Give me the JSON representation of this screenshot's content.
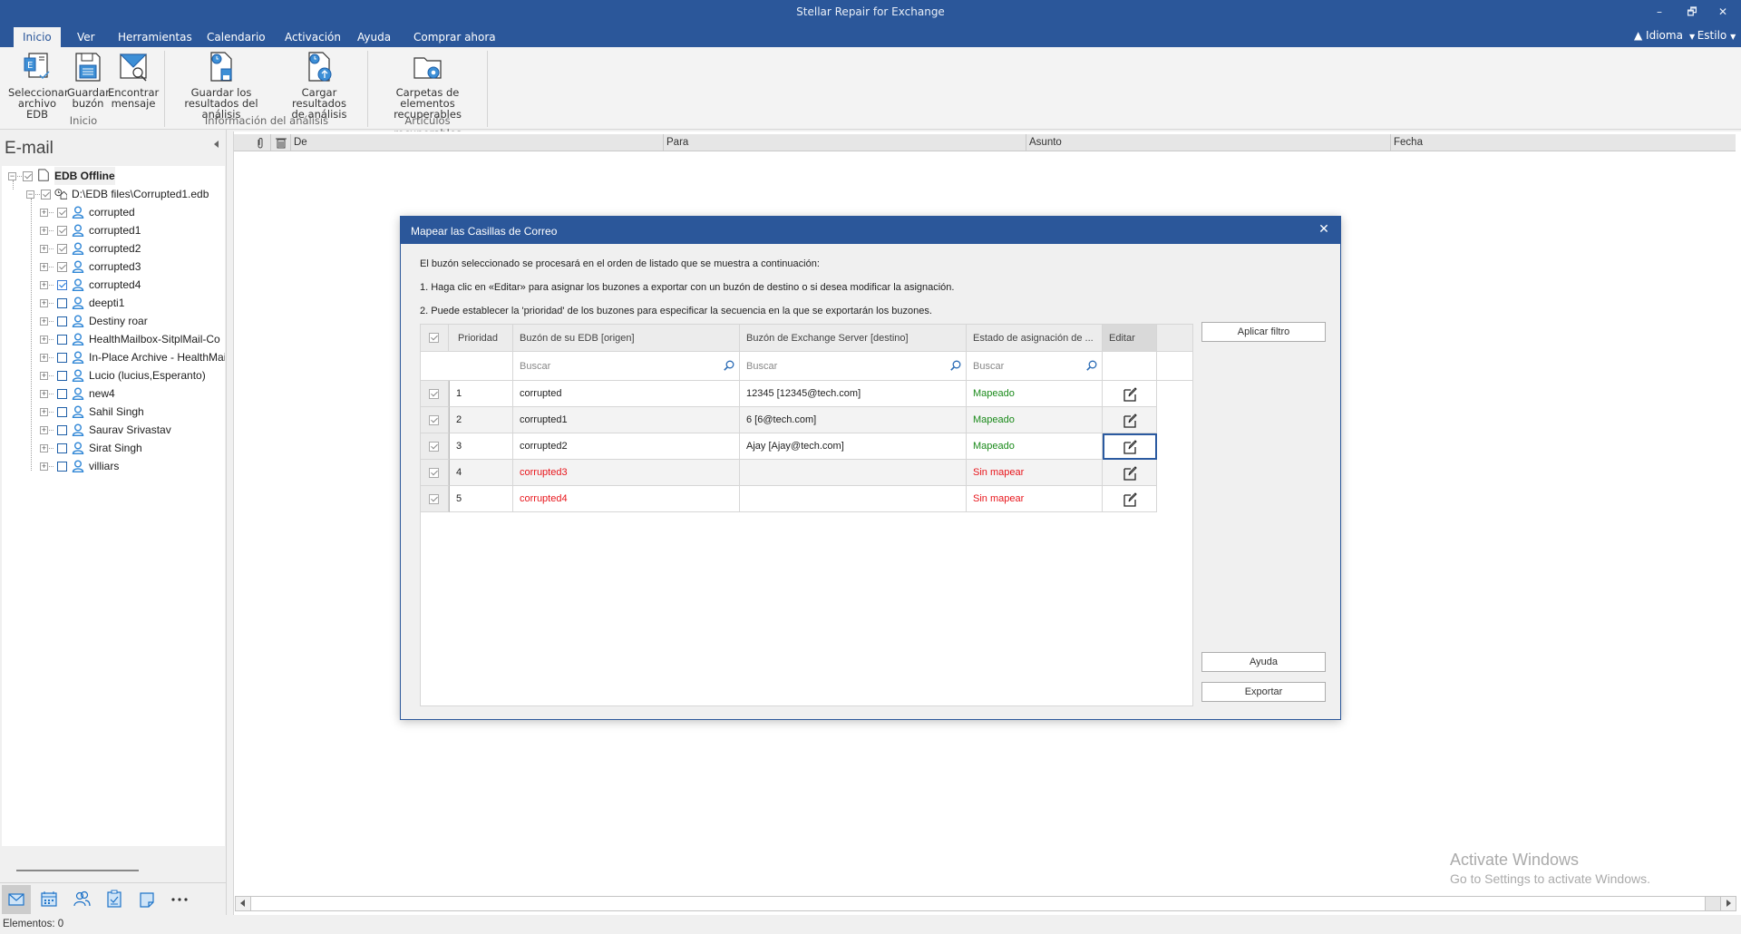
{
  "window": {
    "title": "Stellar Repair for Exchange",
    "controls": {
      "minimize": "–",
      "restore": "🗗",
      "close": "✕"
    }
  },
  "tabs": [
    {
      "label": "Inicio",
      "active": true
    },
    {
      "label": "Ver"
    },
    {
      "label": "Herramientas"
    },
    {
      "label": "Calendario"
    },
    {
      "label": "Activación"
    },
    {
      "label": "Ayuda"
    },
    {
      "label": "Comprar ahora"
    }
  ],
  "right_options": {
    "idioma": "Idioma",
    "estilo": "Estilo"
  },
  "ribbon": {
    "groups": [
      {
        "label": "Inicio",
        "buttons": [
          {
            "line1": "Seleccionar",
            "line2": "archivo EDB",
            "icon": "select-edb-icon"
          },
          {
            "line1": "Guardar",
            "line2": "buzón",
            "icon": "save-mailbox-icon"
          },
          {
            "line1": "Encontrar",
            "line2": "mensaje",
            "icon": "find-message-icon"
          }
        ]
      },
      {
        "label": "Información del análisis",
        "buttons": [
          {
            "line1": "Guardar los",
            "line2": "resultados del análisis",
            "icon": "save-scan-icon"
          },
          {
            "line1": "Cargar resultados",
            "line2": "de análisis",
            "icon": "load-scan-icon"
          }
        ]
      },
      {
        "label": "Artículos recuperables",
        "buttons": [
          {
            "line1": "Carpetas de elementos",
            "line2": "recuperables",
            "icon": "recoverable-folder-icon"
          }
        ]
      }
    ]
  },
  "left_panel": {
    "header": "E-mail",
    "tree": {
      "root": {
        "label": "EDB Offline",
        "checked": true
      },
      "file": {
        "label": "D:\\EDB files\\Corrupted1.edb",
        "checked": true
      },
      "mailboxes": [
        {
          "label": "corrupted",
          "checked": true
        },
        {
          "label": "corrupted1",
          "checked": true
        },
        {
          "label": "corrupted2",
          "checked": true
        },
        {
          "label": "corrupted3",
          "checked": true
        },
        {
          "label": "corrupted4",
          "checked": true
        },
        {
          "label": "deepti1",
          "checked": false
        },
        {
          "label": "Destiny roar",
          "checked": false
        },
        {
          "label": "HealthMailbox-SitplMail-Co",
          "checked": false
        },
        {
          "label": "In-Place Archive - HealthMai",
          "checked": false
        },
        {
          "label": "Lucio (lucius,Esperanto)",
          "checked": false
        },
        {
          "label": "new4",
          "checked": false
        },
        {
          "label": "Sahil Singh",
          "checked": false
        },
        {
          "label": "Saurav Srivastav",
          "checked": false
        },
        {
          "label": "Sirat Singh",
          "checked": false
        },
        {
          "label": "villiars",
          "checked": false
        }
      ]
    },
    "nav": [
      "mail-icon",
      "calendar-icon",
      "contacts-icon",
      "tasks-icon",
      "notes-icon",
      "more-icon"
    ]
  },
  "list": {
    "columns": [
      "De",
      "Para",
      "Asunto",
      "Fecha"
    ]
  },
  "watermark": {
    "line1": "Activate Windows",
    "line2": "Go to Settings to activate Windows."
  },
  "status": {
    "text": "Elementos: 0"
  },
  "dialog": {
    "title": "Mapear las Casillas de Correo",
    "close": "✕",
    "intro": "El buzón seleccionado se procesará en el orden de listado que se muestra a continuación:",
    "step1": "1. Haga clic en «Editar» para asignar los buzones a exportar con un buzón de destino o si desea modificar la asignación.",
    "step2": "2. Puede establecer la 'prioridad' de los buzones para especificar la secuencia en la que se exportarán los buzones.",
    "grid": {
      "headers": {
        "priority": "Prioridad",
        "source": "Buzón de su EDB [origen]",
        "target": "Buzón de Exchange Server [destino]",
        "status": "Estado de asignación de ...",
        "edit": "Editar"
      },
      "search_placeholder": "Buscar",
      "rows": [
        {
          "checked": true,
          "priority": "1",
          "source": "corrupted",
          "target": "12345 [12345@tech.com]",
          "status": "Mapeado",
          "mapped": true
        },
        {
          "checked": true,
          "priority": "2",
          "source": "corrupted1",
          "target": "6 [6@tech.com]",
          "status": "Mapeado",
          "mapped": true
        },
        {
          "checked": true,
          "priority": "3",
          "source": "corrupted2",
          "target": "Ajay [Ajay@tech.com]",
          "status": "Mapeado",
          "mapped": true
        },
        {
          "checked": true,
          "priority": "4",
          "source": "corrupted3",
          "target": "",
          "status": "Sin mapear",
          "mapped": false
        },
        {
          "checked": true,
          "priority": "5",
          "source": "corrupted4",
          "target": "",
          "status": "Sin mapear",
          "mapped": false
        }
      ]
    },
    "buttons": {
      "apply_filter": "Aplicar filtro",
      "help": "Ayuda",
      "export": "Exportar"
    }
  },
  "colors": {
    "accent": "#2b579a",
    "mapped": "#1a8a1a",
    "unmapped": "#e8161c",
    "icon_blue": "#1e73c8"
  }
}
